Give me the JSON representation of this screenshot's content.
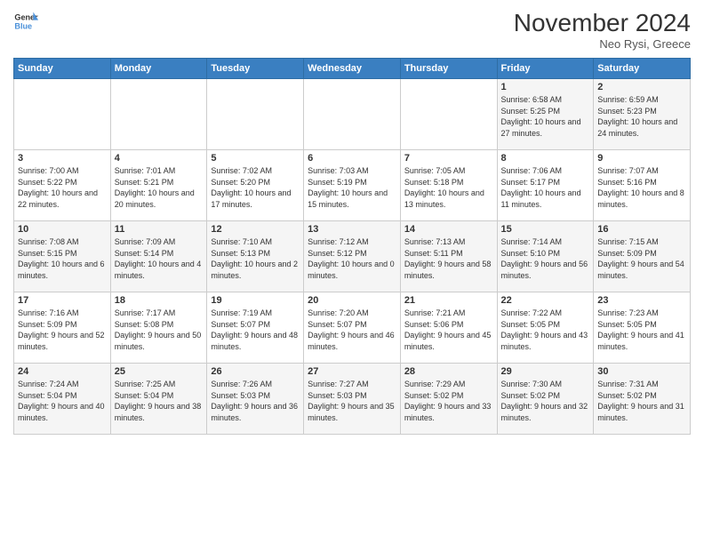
{
  "header": {
    "logo_line1": "General",
    "logo_line2": "Blue",
    "month": "November 2024",
    "location": "Neo Rysi, Greece"
  },
  "weekdays": [
    "Sunday",
    "Monday",
    "Tuesday",
    "Wednesday",
    "Thursday",
    "Friday",
    "Saturday"
  ],
  "weeks": [
    [
      {
        "day": "",
        "info": ""
      },
      {
        "day": "",
        "info": ""
      },
      {
        "day": "",
        "info": ""
      },
      {
        "day": "",
        "info": ""
      },
      {
        "day": "",
        "info": ""
      },
      {
        "day": "1",
        "info": "Sunrise: 6:58 AM\nSunset: 5:25 PM\nDaylight: 10 hours and 27 minutes."
      },
      {
        "day": "2",
        "info": "Sunrise: 6:59 AM\nSunset: 5:23 PM\nDaylight: 10 hours and 24 minutes."
      }
    ],
    [
      {
        "day": "3",
        "info": "Sunrise: 7:00 AM\nSunset: 5:22 PM\nDaylight: 10 hours and 22 minutes."
      },
      {
        "day": "4",
        "info": "Sunrise: 7:01 AM\nSunset: 5:21 PM\nDaylight: 10 hours and 20 minutes."
      },
      {
        "day": "5",
        "info": "Sunrise: 7:02 AM\nSunset: 5:20 PM\nDaylight: 10 hours and 17 minutes."
      },
      {
        "day": "6",
        "info": "Sunrise: 7:03 AM\nSunset: 5:19 PM\nDaylight: 10 hours and 15 minutes."
      },
      {
        "day": "7",
        "info": "Sunrise: 7:05 AM\nSunset: 5:18 PM\nDaylight: 10 hours and 13 minutes."
      },
      {
        "day": "8",
        "info": "Sunrise: 7:06 AM\nSunset: 5:17 PM\nDaylight: 10 hours and 11 minutes."
      },
      {
        "day": "9",
        "info": "Sunrise: 7:07 AM\nSunset: 5:16 PM\nDaylight: 10 hours and 8 minutes."
      }
    ],
    [
      {
        "day": "10",
        "info": "Sunrise: 7:08 AM\nSunset: 5:15 PM\nDaylight: 10 hours and 6 minutes."
      },
      {
        "day": "11",
        "info": "Sunrise: 7:09 AM\nSunset: 5:14 PM\nDaylight: 10 hours and 4 minutes."
      },
      {
        "day": "12",
        "info": "Sunrise: 7:10 AM\nSunset: 5:13 PM\nDaylight: 10 hours and 2 minutes."
      },
      {
        "day": "13",
        "info": "Sunrise: 7:12 AM\nSunset: 5:12 PM\nDaylight: 10 hours and 0 minutes."
      },
      {
        "day": "14",
        "info": "Sunrise: 7:13 AM\nSunset: 5:11 PM\nDaylight: 9 hours and 58 minutes."
      },
      {
        "day": "15",
        "info": "Sunrise: 7:14 AM\nSunset: 5:10 PM\nDaylight: 9 hours and 56 minutes."
      },
      {
        "day": "16",
        "info": "Sunrise: 7:15 AM\nSunset: 5:09 PM\nDaylight: 9 hours and 54 minutes."
      }
    ],
    [
      {
        "day": "17",
        "info": "Sunrise: 7:16 AM\nSunset: 5:09 PM\nDaylight: 9 hours and 52 minutes."
      },
      {
        "day": "18",
        "info": "Sunrise: 7:17 AM\nSunset: 5:08 PM\nDaylight: 9 hours and 50 minutes."
      },
      {
        "day": "19",
        "info": "Sunrise: 7:19 AM\nSunset: 5:07 PM\nDaylight: 9 hours and 48 minutes."
      },
      {
        "day": "20",
        "info": "Sunrise: 7:20 AM\nSunset: 5:07 PM\nDaylight: 9 hours and 46 minutes."
      },
      {
        "day": "21",
        "info": "Sunrise: 7:21 AM\nSunset: 5:06 PM\nDaylight: 9 hours and 45 minutes."
      },
      {
        "day": "22",
        "info": "Sunrise: 7:22 AM\nSunset: 5:05 PM\nDaylight: 9 hours and 43 minutes."
      },
      {
        "day": "23",
        "info": "Sunrise: 7:23 AM\nSunset: 5:05 PM\nDaylight: 9 hours and 41 minutes."
      }
    ],
    [
      {
        "day": "24",
        "info": "Sunrise: 7:24 AM\nSunset: 5:04 PM\nDaylight: 9 hours and 40 minutes."
      },
      {
        "day": "25",
        "info": "Sunrise: 7:25 AM\nSunset: 5:04 PM\nDaylight: 9 hours and 38 minutes."
      },
      {
        "day": "26",
        "info": "Sunrise: 7:26 AM\nSunset: 5:03 PM\nDaylight: 9 hours and 36 minutes."
      },
      {
        "day": "27",
        "info": "Sunrise: 7:27 AM\nSunset: 5:03 PM\nDaylight: 9 hours and 35 minutes."
      },
      {
        "day": "28",
        "info": "Sunrise: 7:29 AM\nSunset: 5:02 PM\nDaylight: 9 hours and 33 minutes."
      },
      {
        "day": "29",
        "info": "Sunrise: 7:30 AM\nSunset: 5:02 PM\nDaylight: 9 hours and 32 minutes."
      },
      {
        "day": "30",
        "info": "Sunrise: 7:31 AM\nSunset: 5:02 PM\nDaylight: 9 hours and 31 minutes."
      }
    ]
  ]
}
